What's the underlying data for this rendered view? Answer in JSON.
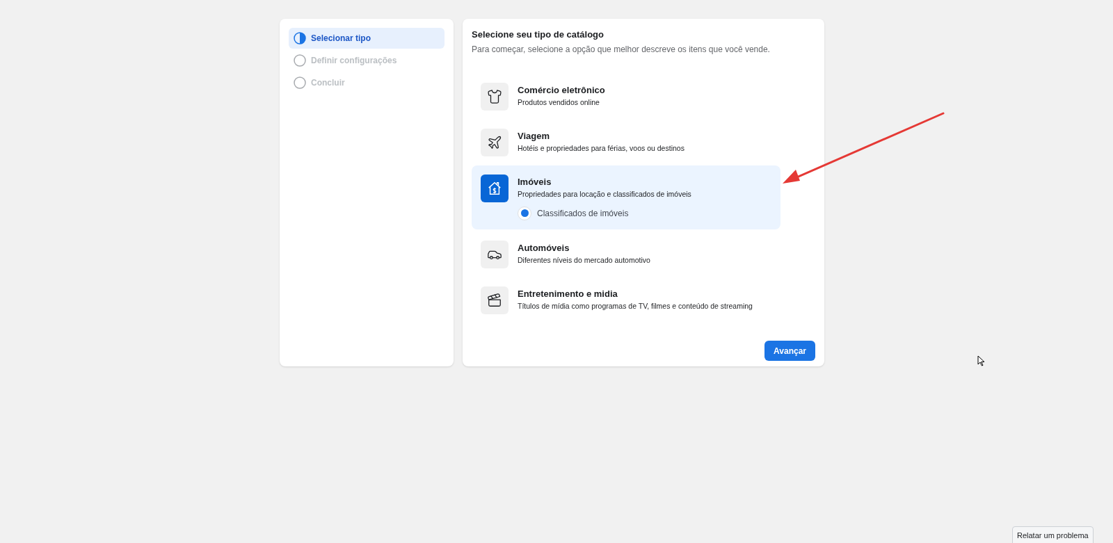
{
  "steps": [
    {
      "label": "Selecionar tipo",
      "selected": true
    },
    {
      "label": "Definir configurações",
      "selected": false
    },
    {
      "label": "Concluir",
      "selected": false
    }
  ],
  "catalog": {
    "title": "Selecione seu tipo de catálogo",
    "subtitle": "Para começar, selecione a opção que melhor descreve os itens que você vende.",
    "options": [
      {
        "kind": "shirt",
        "title": "Comércio eletrônico",
        "description": "Produtos vendidos online",
        "selected": false
      },
      {
        "kind": "plane",
        "title": "Viagem",
        "description": "Hotéis e propriedades para férias, voos ou destinos",
        "selected": false
      },
      {
        "kind": "house",
        "title": "Imóveis",
        "description": "Propriedades para locação e classificados de imóveis",
        "selected": true,
        "sub_options": [
          {
            "label": "Classificados de imóveis",
            "selected": true
          }
        ]
      },
      {
        "kind": "car",
        "title": "Automóveis",
        "description": "Diferentes níveis do mercado automotivo",
        "selected": false
      },
      {
        "kind": "clapper",
        "title": "Entretenimento e midia",
        "description": "Títulos de mídia como programas de TV, filmes e conteúdo de streaming",
        "selected": false
      }
    ],
    "next_button": "Avançar"
  },
  "report_button": "Relatar um problema"
}
